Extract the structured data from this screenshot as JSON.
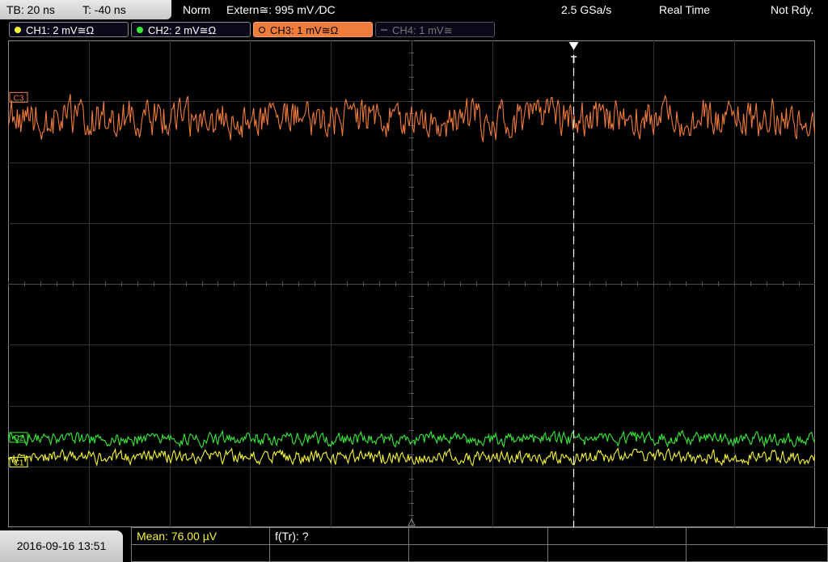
{
  "topbar": {
    "timebase": "TB: 20 ns",
    "trigger_time": "T: -40 ns",
    "trigger_mode": "Norm",
    "trigger_source": "Extern≅: 995 mV ⁄DC",
    "sample_rate": "2.5 GSa/s",
    "acq_mode": "Real Time",
    "status": "Not Rdy."
  },
  "channels": [
    {
      "label": "CH1: 2 mV≅Ω",
      "color": "#f4f43a",
      "state": "on"
    },
    {
      "label": "CH2: 2 mV≅Ω",
      "color": "#38e838",
      "state": "on"
    },
    {
      "label": "CH3: 1 mV≅Ω",
      "color": "#f07c3c",
      "state": "active"
    },
    {
      "label": "CH4: 1 mV≅",
      "color": "#666666",
      "state": "off"
    }
  ],
  "markers": {
    "ch1": "C1",
    "ch2": "C2",
    "ch3": "C3",
    "trigger": "T"
  },
  "chart_data": {
    "type": "line",
    "xlabel": "",
    "ylabel": "",
    "grid": true,
    "divisions": {
      "x": 10,
      "y": 8
    },
    "trigger_x_div": 7,
    "series": [
      {
        "channel": "CH3",
        "color": "#f07c3c",
        "baseline_div": 1.28,
        "amplitude_div": 0.35
      },
      {
        "channel": "CH2",
        "color": "#38e838",
        "baseline_div": 6.55,
        "amplitude_div": 0.12
      },
      {
        "channel": "CH1",
        "color": "#f4f43a",
        "baseline_div": 6.85,
        "amplitude_div": 0.12
      }
    ]
  },
  "bottombar": {
    "datetime": "2016-09-16 13:51",
    "mean": "Mean: 76.00 µV",
    "freq": "f(Tr): ?"
  }
}
